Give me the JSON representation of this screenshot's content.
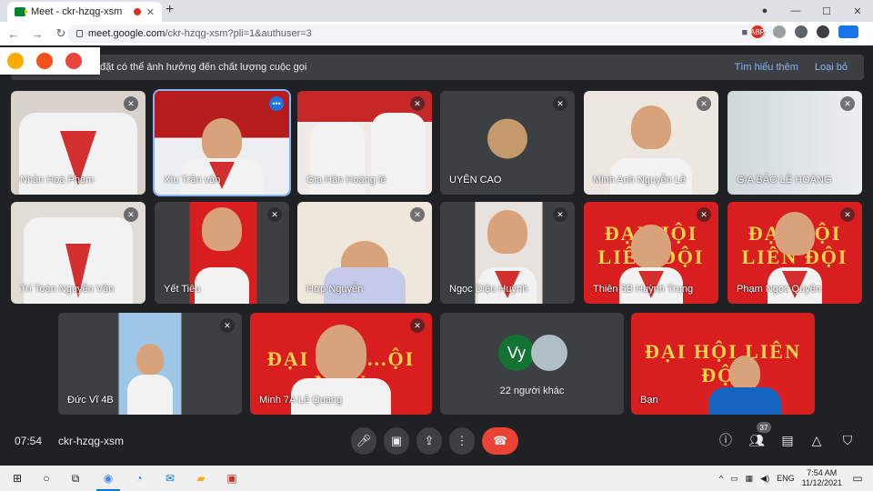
{
  "browser": {
    "tab_title": "Meet - ckr-hzqg-xsm",
    "url_host": "meet.google.com",
    "url_path": "/ckr-hzqg-xsm?pli=1&authuser=3",
    "new_tab": "+",
    "close_tab": "✕",
    "min": "—",
    "max": "☐",
    "close": "✕"
  },
  "banner": {
    "message": "đặt có thể ảnh hưởng đến chất lượng cuộc gọi",
    "learn_more": "Tìm hiểu thêm",
    "dismiss": "Loại bỏ"
  },
  "participants": [
    {
      "name": "Nhân Hoà Phạm"
    },
    {
      "name": "Xíu Trần văn"
    },
    {
      "name": "Gia Hân Hoàng lê"
    },
    {
      "name": "UYÊN CAO"
    },
    {
      "name": "Minh Anh Nguyễn Lê"
    },
    {
      "name": "GIA BẢO LÊ HOÀNG"
    },
    {
      "name": "Trí Toàn Nguyễn Văn"
    },
    {
      "name": "Yết Tiêu"
    },
    {
      "name": "Hợp Nguyễn"
    },
    {
      "name": "Ngọc Diệu Huỳnh"
    },
    {
      "name": "Thiên 5B Huỳnh Trung"
    },
    {
      "name": "Phạm Ngọc Quyên"
    },
    {
      "name": "Đức Vĩ 4B"
    },
    {
      "name": "Minh 7A Lê Quang"
    },
    {
      "name": "Bạn"
    }
  ],
  "banner_text": {
    "t1": "ĐẠI HỘI LIÊN ĐỘI",
    "t2": "ĐẠI HỘI LIÊN ĐỘI",
    "t3": "ĐẠI HỘI ...ỘI MẪU",
    "t4": "ĐẠI HỘI LIÊN ĐỘI"
  },
  "others": {
    "initials": "Vy",
    "count_label": "22 người khác"
  },
  "meeting": {
    "time": "07:54",
    "code": "ckr-hzqg-xsm",
    "people_count": "37"
  },
  "taskbar": {
    "time": "7:54 AM",
    "date": "11/12/2021",
    "lang": "ENG"
  }
}
